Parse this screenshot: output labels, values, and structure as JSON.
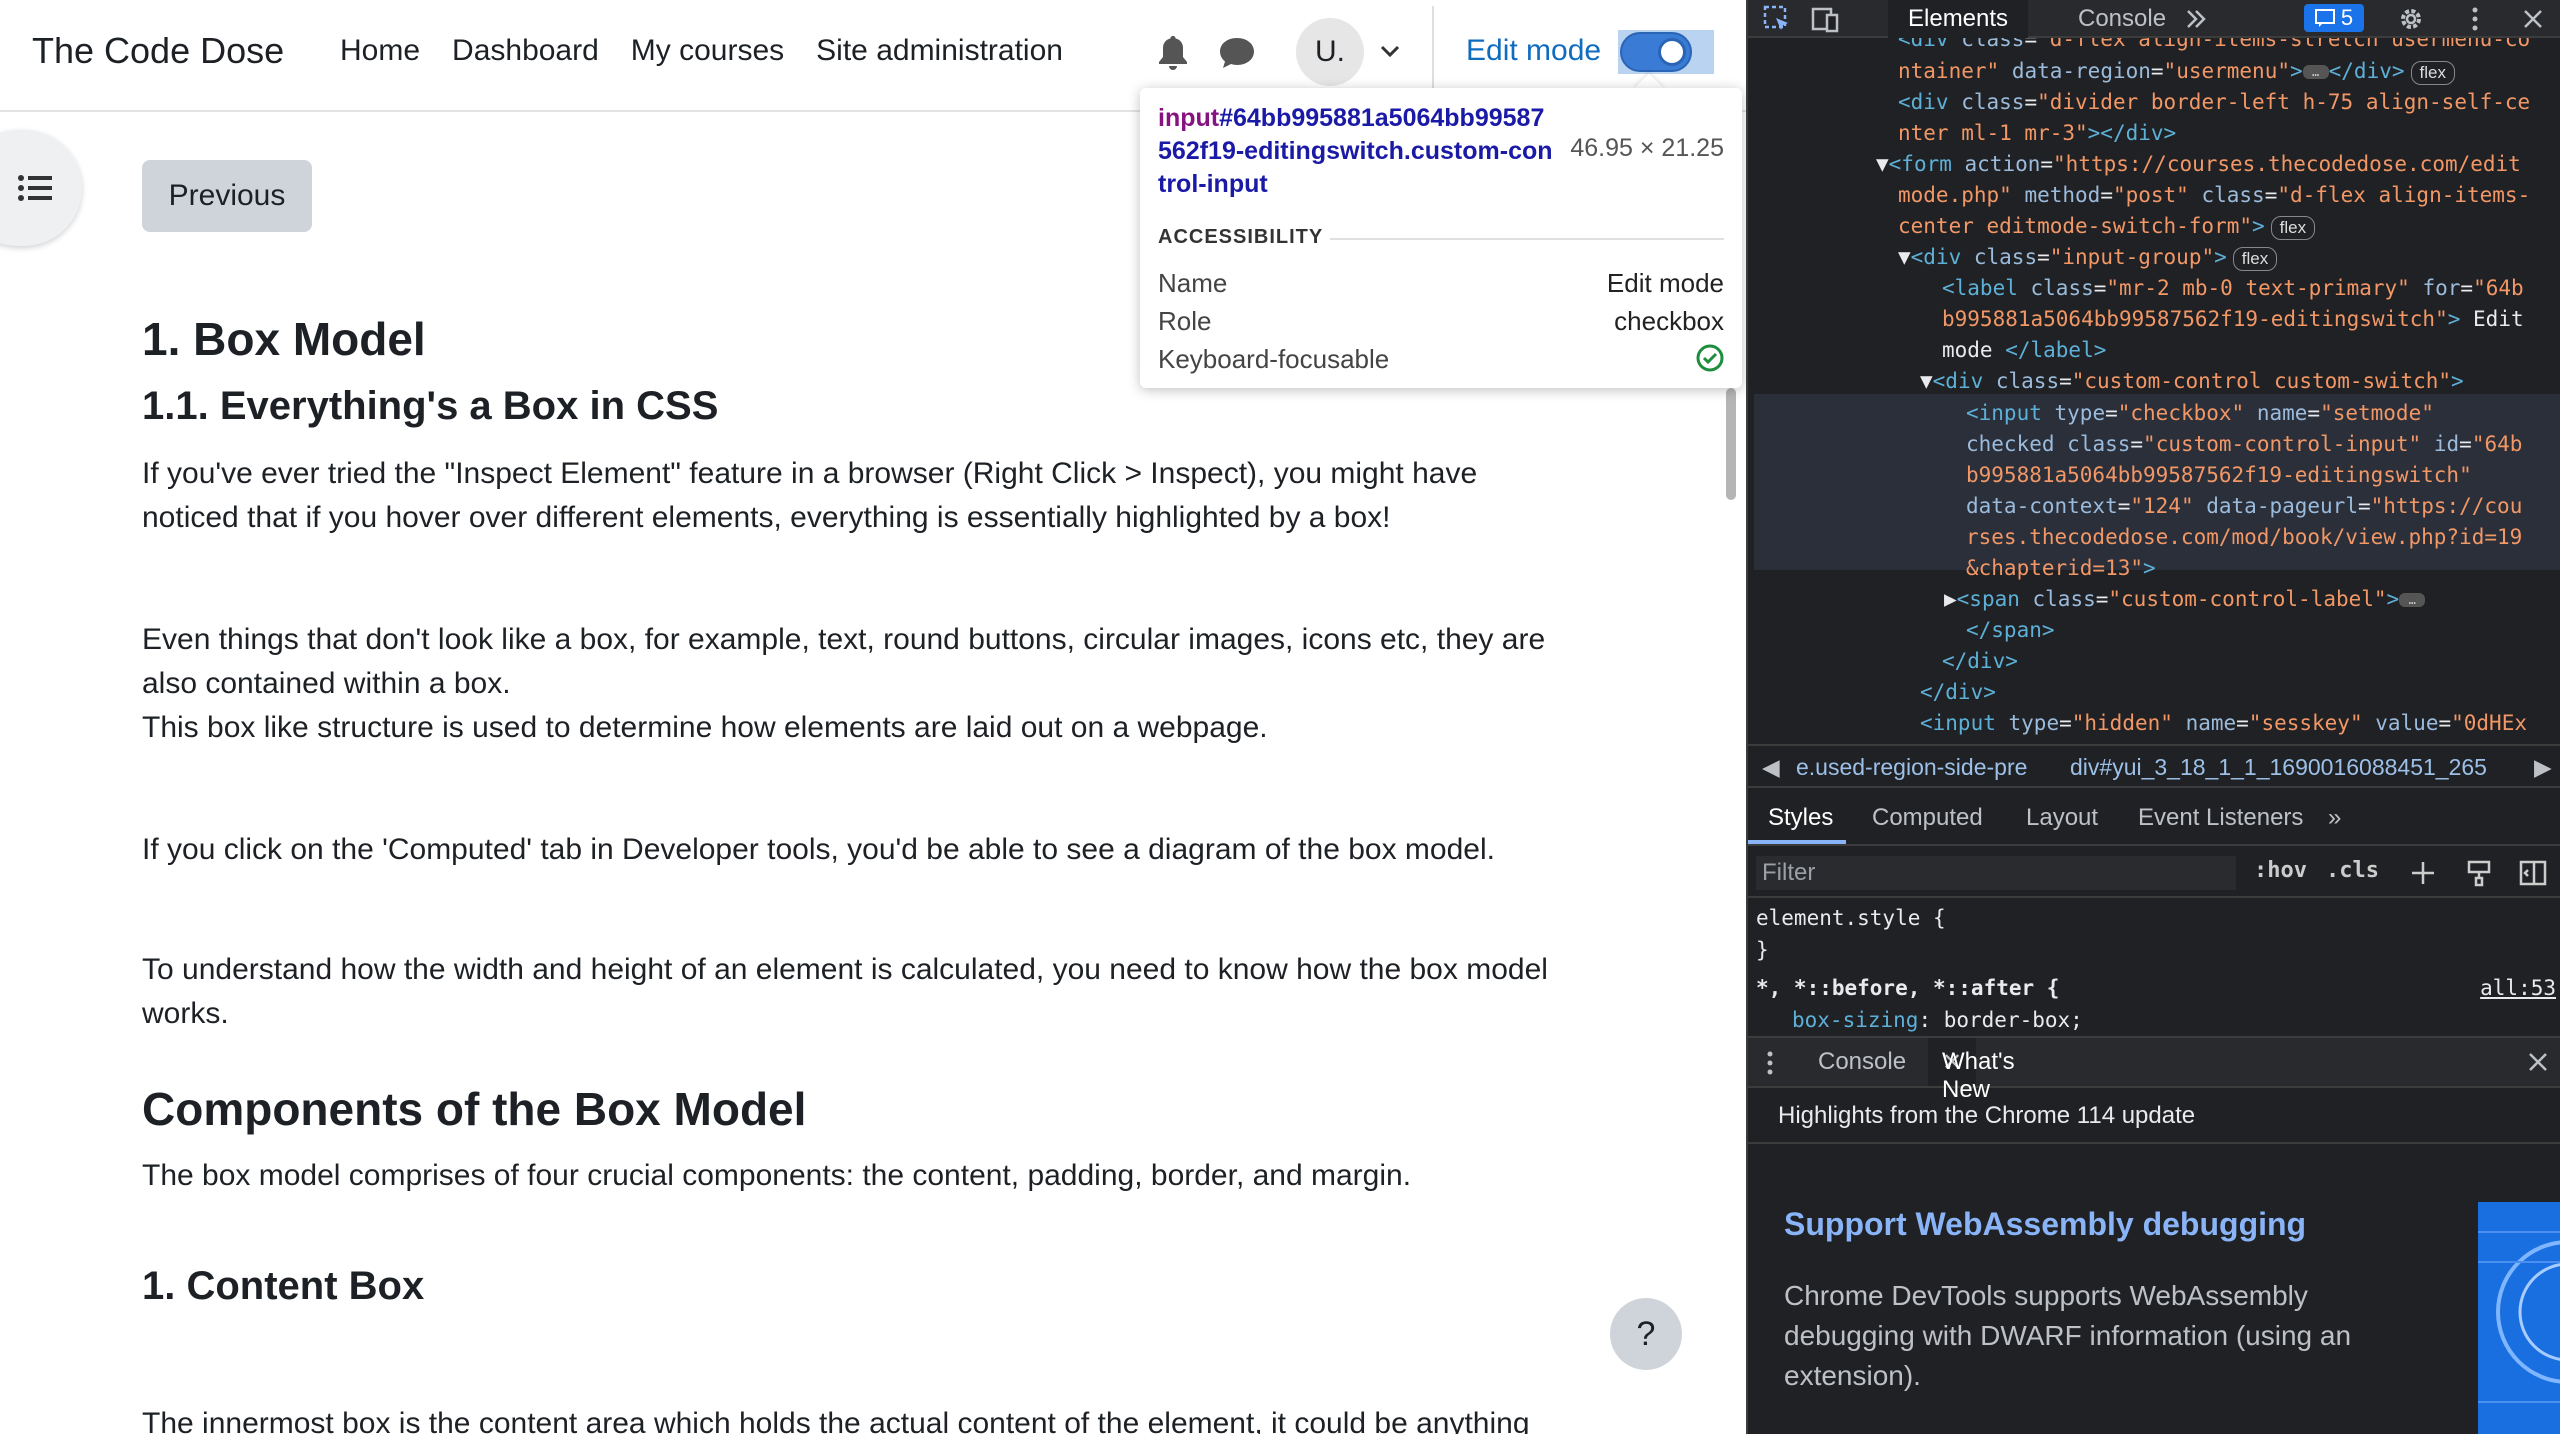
{
  "navbar": {
    "brand": "The Code Dose",
    "links": [
      "Home",
      "Dashboard",
      "My courses",
      "Site administration"
    ],
    "avatar_initials": "U.",
    "edit_mode_label": "Edit mode",
    "edit_mode_on": true
  },
  "page": {
    "previous_label": "Previous",
    "h1": "1. Box Model",
    "h2": "1.1. Everything's a Box in CSS",
    "p1a": "If you've ever tried the \"Inspect Element\" feature in a browser (Right Click > Inspect), you might have",
    "p1b": "noticed that if you hover over different elements, everything is essentially highlighted by a box!",
    "p2a": "Even things that don't look like a box, for example, text, round buttons, circular images, icons etc, they are",
    "p2b": "also contained within a box.",
    "p2c": "This box like structure is used to determine how elements are laid out on a webpage.",
    "p3": "If you click on the 'Computed' tab in Developer tools, you'd be able to see a diagram of the box model.",
    "p4a": "To understand how the width and height of an element is calculated, you need to know how the box model",
    "p4b": "works.",
    "h2b": "Components of the Box Model",
    "p5": "The box model comprises of four crucial components: the content, padding, border, and margin.",
    "h3": "1. Content Box",
    "p6": "The innermost box is the content area which holds the actual content of the element, it could be anything",
    "help_label": "?"
  },
  "tooltip": {
    "tag": "input",
    "selector": "#64bb995881a5064bb99587562f19-editingswitch.custom-control-input",
    "size": "46.95 × 21.25",
    "section": "ACCESSIBILITY",
    "name_label": "Name",
    "name_value": "Edit mode",
    "role_label": "Role",
    "role_value": "checkbox",
    "focus_label": "Keyboard-focusable"
  },
  "devtools": {
    "tabs": [
      "Elements",
      "Console"
    ],
    "issues_count": "5",
    "breadcrumb_1": "e.used-region-side-pre",
    "breadcrumb_2": "div#yui_3_18_1_1_1690016088451_265",
    "styles_tabs": [
      "Styles",
      "Computed",
      "Layout",
      "Event Listeners"
    ],
    "filter_placeholder": "Filter",
    "hov": ":hov",
    "cls": ".cls",
    "rule1": "element.style {",
    "rule1_close": "}",
    "rule2_selector": "*, *::before, *::after {",
    "rule2_prop": "box-sizing",
    "rule2_value": "border-box;",
    "rule2_link": "all:53",
    "drawer_tabs": [
      "Console",
      "What's New"
    ],
    "headline": "Highlights from the Chrome 114 update",
    "whatsnew_title": "Support WebAssembly debugging",
    "whatsnew_body_1": "Chrome DevTools supports WebAssembly",
    "whatsnew_body_2": "debugging with DWARF information (using an",
    "whatsnew_body_3": "extension)."
  },
  "colors": {
    "accent": "#0f6cbf",
    "devtools_bg": "#202124",
    "link_blue": "#8ab4f8"
  }
}
